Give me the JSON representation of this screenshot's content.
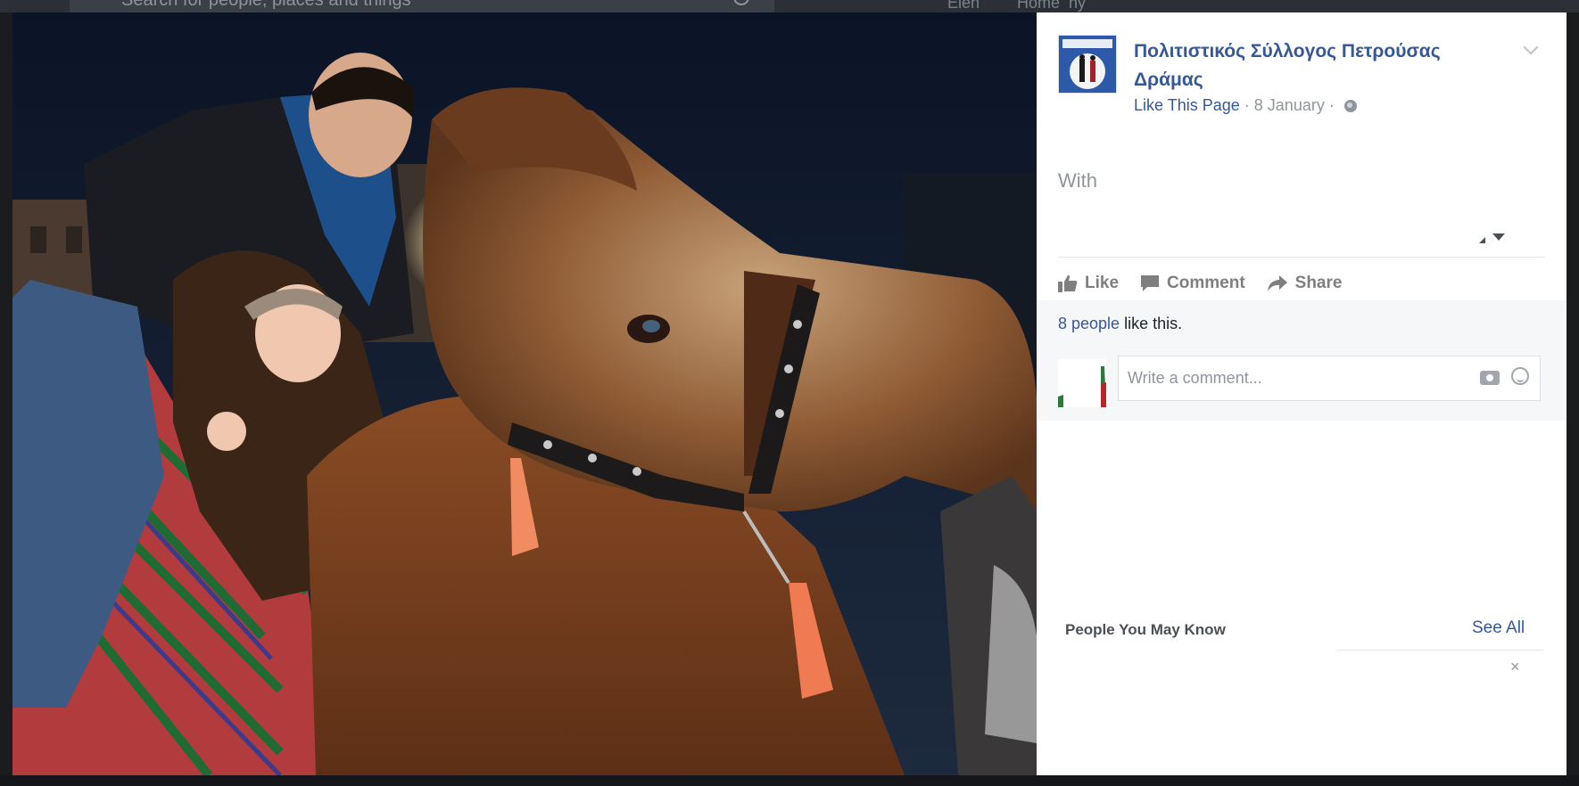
{
  "topbar": {
    "search_placeholder": "Search for people, places and things",
    "nav_items": [
      "Elen",
      "Home",
      "ny"
    ]
  },
  "post": {
    "page_name": "Πολιτιστικός Σύλλογος Πετρούσας Δράμας",
    "like_link": "Like This Page",
    "separator": "·",
    "date": "8 January",
    "with_label": "With",
    "actions": {
      "like": "Like",
      "comment": "Comment",
      "share": "Share"
    },
    "likes_count": "8 people",
    "likes_suffix": " like this.",
    "comment_placeholder": "Write a comment...",
    "icons": [
      "chevron-down-icon",
      "globe-icon",
      "like-icon",
      "comment-icon",
      "share-icon",
      "camera-icon",
      "emoji-icon"
    ]
  },
  "sidebar": {
    "pymk_title": "People You May Know",
    "see_all": "See All",
    "close": "×"
  },
  "colors": {
    "link": "#365899",
    "muted": "#90949c",
    "action": "#7f7f7f"
  }
}
